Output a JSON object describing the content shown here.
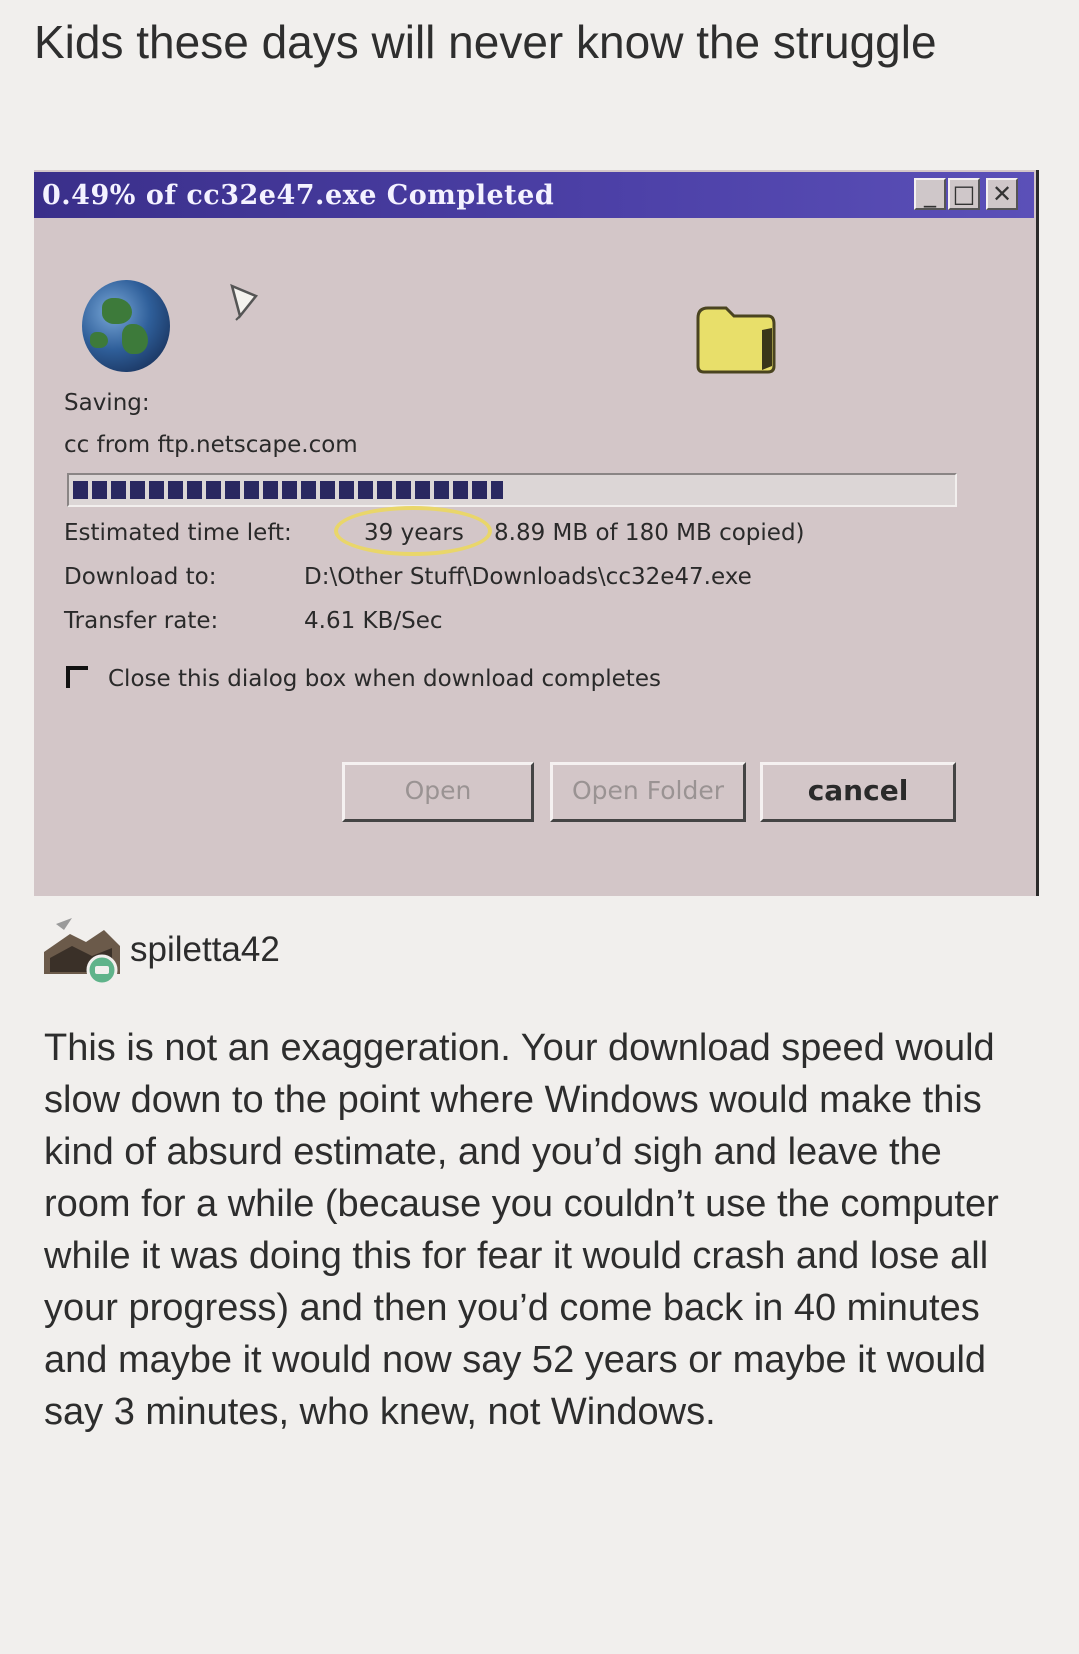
{
  "post": {
    "title": "Kids these days will never know the struggle",
    "username": "spiletta42",
    "body": "This is not an exaggeration.  Your download speed would slow down to the point where Windows would make this kind of absurd estimate, and you’d sigh and leave the room for a while (because you couldn’t use the computer while it was doing this for fear it would crash and lose all your progress) and then you’d come back in 40 minutes and maybe it would now say 52 years or maybe it would say 3 minutes, who knew, not Windows."
  },
  "dialog": {
    "title": "0.49% of cc32e47.exe Completed",
    "window_buttons": {
      "minimize": "_",
      "maximize": "□",
      "close": "✕"
    },
    "icons": {
      "source": "globe-icon",
      "transfer": "paper-icon",
      "destination": "folder-icon"
    },
    "saving_label": "Saving:",
    "source": "cc from ftp.netscape.com",
    "progress_fraction": 0.49,
    "estimated_label": "Estimated time left:",
    "estimated_value": "39 years",
    "copied_value": "8.89 MB of 180 MB copied)",
    "download_to_label": "Download to:",
    "download_to_value": "D:\\Other Stuff\\Downloads\\cc32e47.exe",
    "transfer_rate_label": "Transfer rate:",
    "transfer_rate_value": "4.61 KB/Sec",
    "checkbox_label": "Close this dialog box when download completes",
    "buttons": {
      "open": "Open",
      "open_folder": "Open Folder",
      "cancel": "cancel"
    },
    "colors": {
      "titlebar": "#3a2f8a",
      "face": "#d3c6c8",
      "highlight": "#e9d66a"
    }
  }
}
